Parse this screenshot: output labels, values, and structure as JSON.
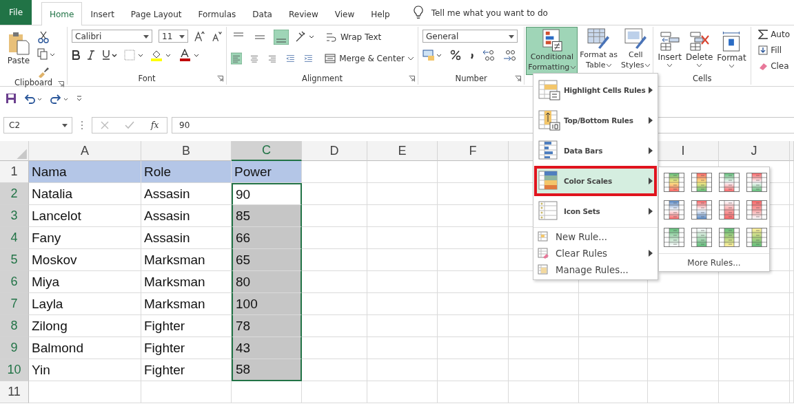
{
  "tabs": [
    {
      "label": "File",
      "kind": "file",
      "selected": false
    },
    {
      "label": "Home",
      "kind": "tab",
      "selected": true
    },
    {
      "label": "Insert",
      "kind": "tab",
      "selected": false
    },
    {
      "label": "Page Layout",
      "kind": "tab",
      "selected": false
    },
    {
      "label": "Formulas",
      "kind": "tab",
      "selected": false
    },
    {
      "label": "Data",
      "kind": "tab",
      "selected": false
    },
    {
      "label": "Review",
      "kind": "tab",
      "selected": false
    },
    {
      "label": "View",
      "kind": "tab",
      "selected": false
    },
    {
      "label": "Help",
      "kind": "tab",
      "selected": false
    }
  ],
  "tell_me": "Tell me what you want to do",
  "ribbon": {
    "clipboard": {
      "paste": "Paste",
      "label": "Clipboard"
    },
    "font": {
      "name": "Calibri",
      "size": "11",
      "label": "Font"
    },
    "alignment": {
      "wrap": "Wrap Text",
      "merge": "Merge & Center",
      "label": "Alignment"
    },
    "number": {
      "format": "General",
      "label": "Number"
    },
    "styles": [
      {
        "lines": [
          "Conditional",
          "Formatting"
        ],
        "kind": "conditional",
        "selected": true
      },
      {
        "lines": [
          "Format as",
          "Table"
        ],
        "kind": "table",
        "selected": false
      },
      {
        "lines": [
          "Cell",
          "Styles"
        ],
        "kind": "styles",
        "selected": false
      }
    ],
    "cells": {
      "buttons": [
        {
          "label": "Insert",
          "kind": "insert"
        },
        {
          "label": "Delete",
          "kind": "delete"
        },
        {
          "label": "Format",
          "kind": "format"
        }
      ],
      "label": "Cells"
    },
    "editing": [
      {
        "label": "Auto",
        "kind": "sum"
      },
      {
        "label": "Fill",
        "kind": "fill"
      },
      {
        "label": "Clea",
        "kind": "clear"
      }
    ]
  },
  "formula_bar": {
    "name_box": "C2",
    "fx": "fx",
    "value": "90"
  },
  "sheet": {
    "columns": [
      {
        "label": "A",
        "selected": false
      },
      {
        "label": "B",
        "selected": false
      },
      {
        "label": "C",
        "selected": true
      },
      {
        "label": "D",
        "selected": false
      },
      {
        "label": "E",
        "selected": false
      },
      {
        "label": "F",
        "selected": false
      },
      {
        "label": "I",
        "selected": false
      },
      {
        "label": "J",
        "selected": false
      }
    ],
    "rows": [
      {
        "label": "1",
        "color": "#b4c6e7",
        "selected": false,
        "active": false,
        "cells": [
          "Nama",
          "Role",
          "Power"
        ]
      },
      {
        "label": "2",
        "selected": true,
        "active": true,
        "cells": [
          "Natalia",
          "Assasin",
          "90"
        ]
      },
      {
        "label": "3",
        "selected": true,
        "active": false,
        "cells": [
          "Lancelot",
          "Assasin",
          "85"
        ]
      },
      {
        "label": "4",
        "selected": true,
        "active": false,
        "cells": [
          "Fany",
          "Assasin",
          "66"
        ]
      },
      {
        "label": "5",
        "selected": true,
        "active": false,
        "cells": [
          "Moskov",
          "Marksman",
          "65"
        ]
      },
      {
        "label": "6",
        "selected": true,
        "active": false,
        "cells": [
          "Miya",
          "Marksman",
          "80"
        ]
      },
      {
        "label": "7",
        "selected": true,
        "active": false,
        "cells": [
          "Layla",
          "Marksman",
          "100"
        ]
      },
      {
        "label": "8",
        "selected": true,
        "active": false,
        "cells": [
          "Zilong",
          "Fighter",
          "78"
        ]
      },
      {
        "label": "9",
        "selected": true,
        "active": false,
        "cells": [
          "Balmond",
          "Fighter",
          "43"
        ]
      },
      {
        "label": "10",
        "selected": true,
        "active": false,
        "cells": [
          "Yin",
          "Fighter",
          "58"
        ]
      },
      {
        "label": "11",
        "selected": false,
        "active": false,
        "cells": []
      }
    ]
  },
  "menu": {
    "items": [
      {
        "label": "Highlight Cells Rules",
        "kind": "highlight",
        "submenu": true,
        "selected": false
      },
      {
        "label": "Top/Bottom Rules",
        "kind": "topbottom",
        "submenu": true,
        "selected": false
      },
      {
        "label": "Data Bars",
        "kind": "databars",
        "submenu": true,
        "selected": false
      },
      {
        "label": "Color Scales",
        "kind": "colorscales",
        "submenu": true,
        "selected": true
      },
      {
        "label": "Icon Sets",
        "kind": "iconsets",
        "submenu": true,
        "selected": false
      },
      {
        "label": "New Rule...",
        "kind": "new",
        "submenu": false,
        "selected": false
      },
      {
        "label": "Clear Rules",
        "kind": "clear",
        "submenu": true,
        "selected": false
      },
      {
        "label": "Manage Rules...",
        "kind": "manage",
        "submenu": false,
        "selected": false
      }
    ],
    "submenu": {
      "more": "More Rules..."
    }
  }
}
